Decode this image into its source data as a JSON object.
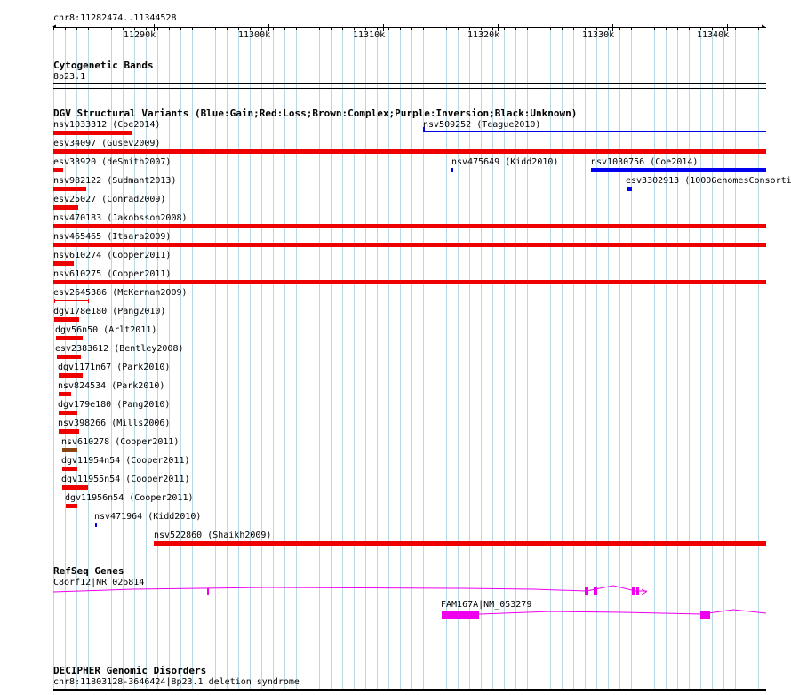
{
  "ruler": {
    "position": "chr8:11282474..11344528",
    "ticks": [
      "11290k",
      "11300k",
      "11310k",
      "11320k",
      "11330k",
      "11340k"
    ]
  },
  "tracks": {
    "cytobands": {
      "title": "Cytogenetic Bands",
      "band": "8p23.1"
    },
    "dgv": {
      "title": "DGV Structural Variants (Blue:Gain;Red:Loss;Brown:Complex;Purple:Inversion;Black:Unknown)",
      "features": [
        {
          "label": "nsv1033312 (Coe2014)",
          "type": "loss"
        },
        {
          "label": "nsv509252 (Teague2010)",
          "type": "gain"
        },
        {
          "label": "esv34097 (Gusev2009)",
          "type": "loss"
        },
        {
          "label": "esv33920 (deSmith2007)",
          "type": "loss"
        },
        {
          "label": "nsv475649 (Kidd2010)",
          "type": "gain"
        },
        {
          "label": "nsv1030756 (Coe2014)",
          "type": "gain"
        },
        {
          "label": "nsv982122 (Sudmant2013)",
          "type": "loss"
        },
        {
          "label": "esv3302913 (1000GenomesConsorti",
          "type": "gain"
        },
        {
          "label": "esv25027 (Conrad2009)",
          "type": "loss"
        },
        {
          "label": "nsv470183 (Jakobsson2008)",
          "type": "loss"
        },
        {
          "label": "nsv465465 (Itsara2009)",
          "type": "loss"
        },
        {
          "label": "nsv610274 (Cooper2011)",
          "type": "loss"
        },
        {
          "label": "nsv610275 (Cooper2011)",
          "type": "loss"
        },
        {
          "label": "esv2645386 (McKernan2009)",
          "type": "loss"
        },
        {
          "label": "dgv178e180 (Pang2010)",
          "type": "loss"
        },
        {
          "label": "dgv56n50 (Arlt2011)",
          "type": "loss"
        },
        {
          "label": "esv2383612 (Bentley2008)",
          "type": "loss"
        },
        {
          "label": "dgv1171n67 (Park2010)",
          "type": "loss"
        },
        {
          "label": "nsv824534 (Park2010)",
          "type": "loss"
        },
        {
          "label": "dgv179e180 (Pang2010)",
          "type": "loss"
        },
        {
          "label": "nsv398266 (Mills2006)",
          "type": "loss"
        },
        {
          "label": "nsv610278 (Cooper2011)",
          "type": "complex"
        },
        {
          "label": "dgv11954n54 (Cooper2011)",
          "type": "loss"
        },
        {
          "label": "dgv11955n54 (Cooper2011)",
          "type": "loss"
        },
        {
          "label": "dgv11956n54 (Cooper2011)",
          "type": "loss"
        },
        {
          "label": "nsv471964 (Kidd2010)",
          "type": "gain"
        },
        {
          "label": "nsv522860 (Shaikh2009)",
          "type": "loss"
        }
      ]
    },
    "refseq": {
      "title": "RefSeq Genes",
      "genes": [
        {
          "label": "C8orf12|NR_026814"
        },
        {
          "label": "FAM167A|NM_053279"
        }
      ]
    },
    "decipher": {
      "title": "DECIPHER Genomic Disorders",
      "feature": "chr8:11803128-3646424|8p23.1 deletion syndrome"
    }
  },
  "colors": {
    "gain": "#0000ee",
    "loss": "#ee0000",
    "complex": "#8b4513",
    "gene": "#ee00ee",
    "grid": "#b8d8e8"
  }
}
